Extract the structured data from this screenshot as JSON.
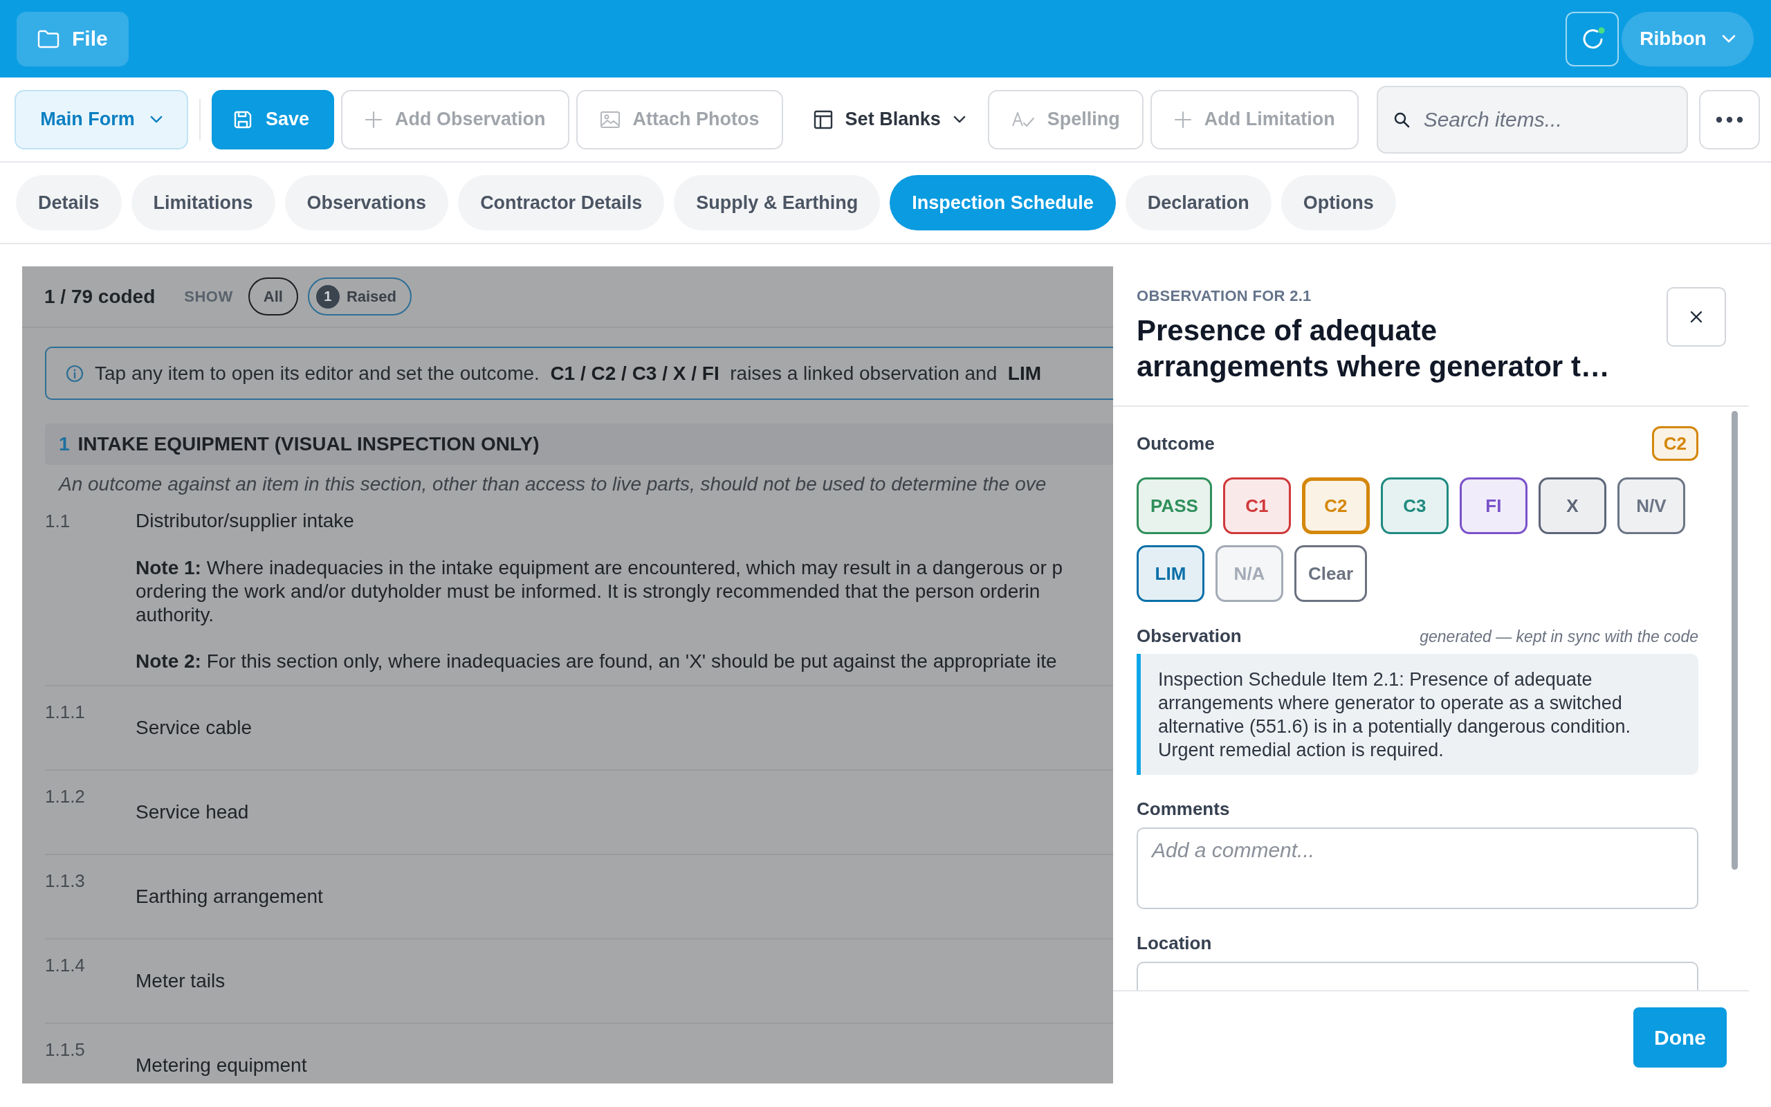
{
  "topbar": {
    "file": "File",
    "ribbon": "Ribbon"
  },
  "toolbar": {
    "form": "Main Form",
    "items": [
      {
        "kind": "primary",
        "label": "Save",
        "disabled": false
      },
      {
        "kind": "button",
        "label": "Add Observation",
        "disabled": true
      },
      {
        "kind": "button",
        "label": "Attach Photos",
        "disabled": true
      },
      {
        "kind": "menu",
        "label": "Set Blanks",
        "disabled": false
      },
      {
        "kind": "button",
        "label": "Spelling",
        "disabled": true
      },
      {
        "kind": "button",
        "label": "Add Limitation",
        "disabled": true
      }
    ],
    "search": {
      "placeholder": "Search items..."
    }
  },
  "tabs": [
    {
      "label": "Details",
      "selected": false
    },
    {
      "label": "Limitations",
      "selected": false
    },
    {
      "label": "Observations",
      "selected": false
    },
    {
      "label": "Contractor Details",
      "selected": false
    },
    {
      "label": "Supply & Earthing",
      "selected": false
    },
    {
      "label": "Inspection Schedule",
      "selected": true
    },
    {
      "label": "Declaration",
      "selected": false
    },
    {
      "label": "Options",
      "selected": false
    }
  ],
  "schedule": {
    "progress": "1 / 79 coded",
    "show_label": "SHOW",
    "filters": [
      {
        "label": "All",
        "selected": true
      },
      {
        "label": "Raised",
        "count": "1",
        "selected": false
      }
    ],
    "info": "Tap any item to open its editor and set the outcome.  **C1 / C2 / C3 / X / FI**  raises a linked observation and  **LIM**",
    "section": {
      "number": "1",
      "title": "INTAKE EQUIPMENT (VISUAL INSPECTION ONLY)",
      "note": "An outcome against an item in this section, other than access to live parts, should not be used to determine the ove"
    },
    "items": [
      {
        "number": "1.1",
        "label": "Distributor/supplier intake",
        "notes": [
          {
            "lines": [
              "**Note 1:** Where inadequacies in the intake equipment are encountered, which may result in a dangerous or p",
              "ordering the work and/or dutyholder must be informed. It is strongly recommended that the person orderin",
              "authority."
            ]
          },
          {
            "lines": [
              "**Note 2:** For this section only, where inadequacies are found, an 'X' should be put against the appropriate ite"
            ]
          }
        ]
      },
      {
        "number": "1.1.1",
        "label": "Service cable"
      },
      {
        "number": "1.1.2",
        "label": "Service head"
      },
      {
        "number": "1.1.3",
        "label": "Earthing arrangement"
      },
      {
        "number": "1.1.4",
        "label": "Meter tails"
      },
      {
        "number": "1.1.5",
        "label": "Metering equipment"
      }
    ]
  },
  "drawer": {
    "eyebrow": "OBSERVATION FOR 2.1",
    "title": "Presence of adequate arrangements where generator t…",
    "outcome": {
      "label": "Outcome",
      "badge": "C2",
      "options": [
        {
          "kind": "code",
          "label": "PASS",
          "color": "#2f8f5b",
          "selected": false
        },
        {
          "kind": "code",
          "label": "C1",
          "color": "#d0393b",
          "selected": false
        },
        {
          "kind": "code",
          "label": "C2",
          "color": "#d4870b",
          "selected": true
        },
        {
          "kind": "code",
          "label": "C3",
          "color": "#1f8a80",
          "selected": false
        },
        {
          "kind": "code",
          "label": "FI",
          "color": "#7a52c9",
          "selected": false
        },
        {
          "kind": "code",
          "label": "X",
          "color": "#5c6677",
          "selected": false
        },
        {
          "kind": "code",
          "label": "N/V",
          "color": "#6b7585",
          "selected": false
        },
        {
          "kind": "code",
          "label": "LIM",
          "color": "#0b6fa8",
          "selected": false
        },
        {
          "kind": "code",
          "label": "N/A",
          "color": "#a3abb6",
          "selected": false
        },
        {
          "kind": "clear",
          "label": "Clear",
          "color": "#6b7280",
          "selected": false
        }
      ]
    },
    "observation": {
      "label": "Observation",
      "hint": "generated — kept in sync with the code",
      "text": "Inspection Schedule Item 2.1: Presence of adequate arrangements where generator to operate as a switched alternative (551.6) is in a potentially dangerous condition. Urgent remedial action is required."
    },
    "comments": {
      "label": "Comments",
      "placeholder": "Add a comment..."
    },
    "location": {
      "label": "Location"
    },
    "done": "Done"
  }
}
